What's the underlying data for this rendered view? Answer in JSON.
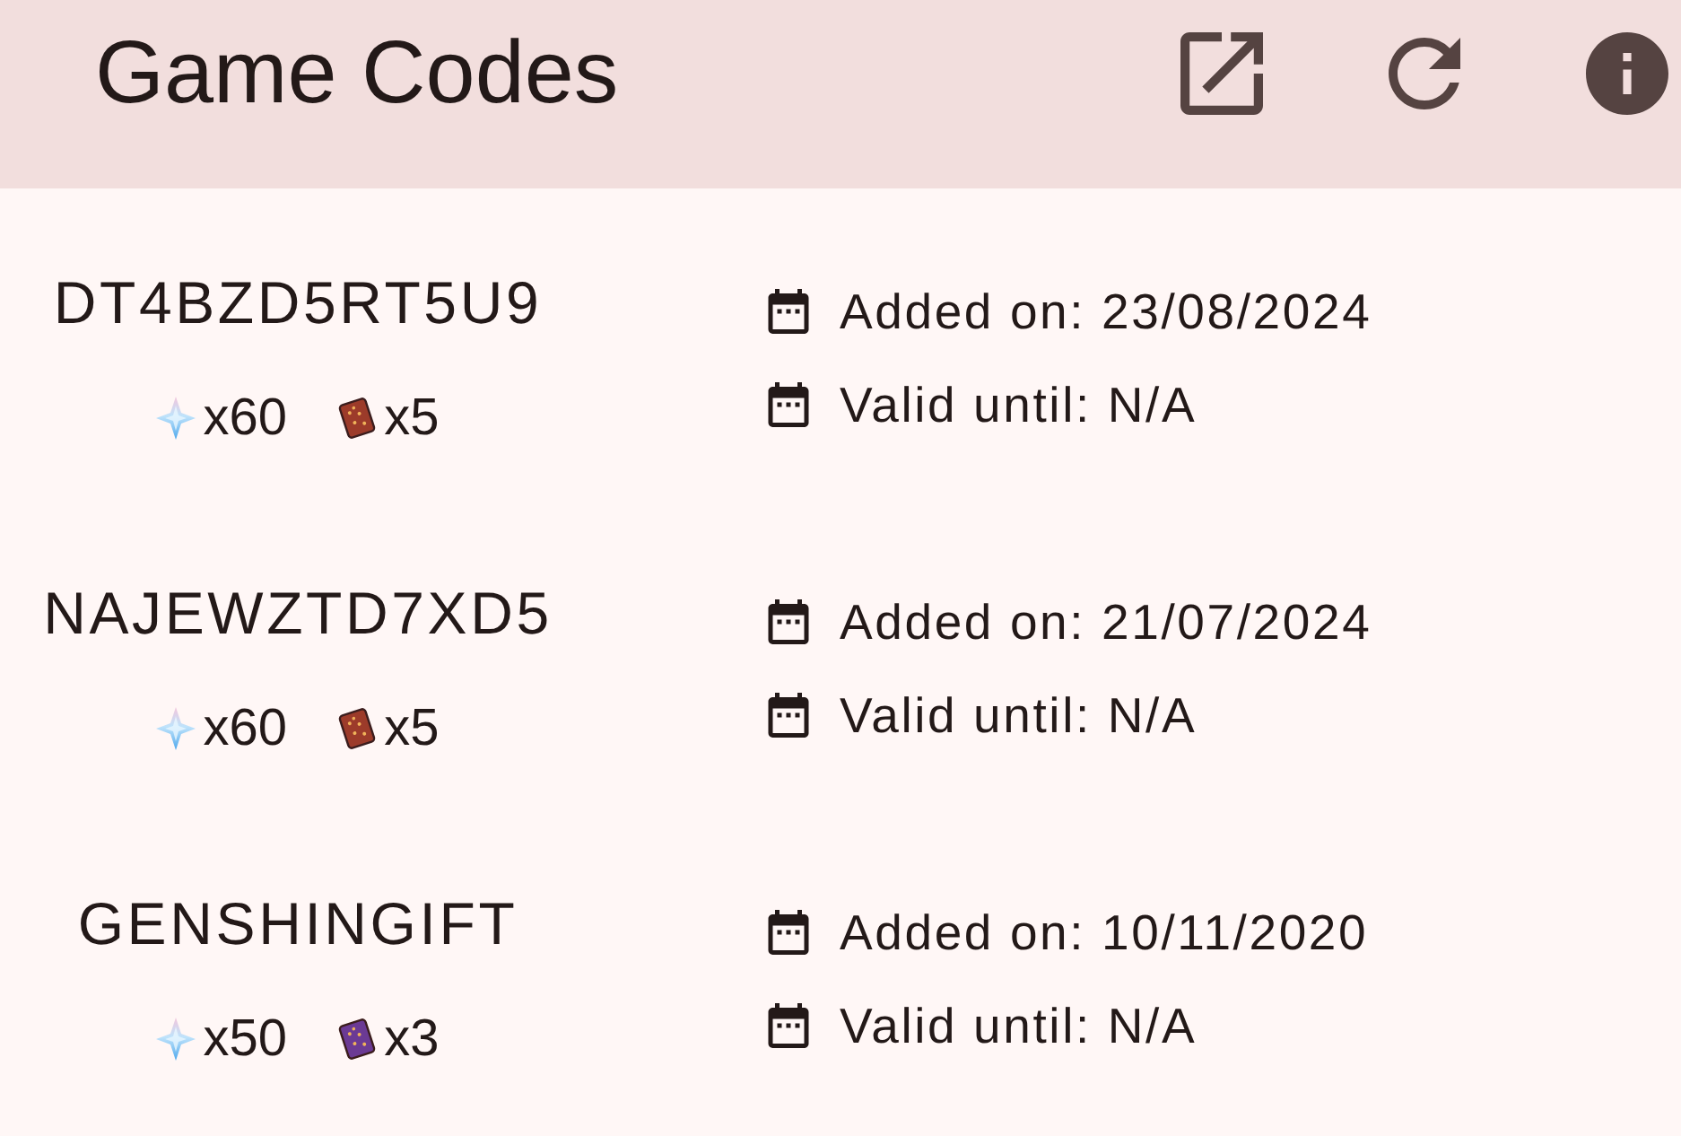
{
  "app_bar": {
    "title": "Game Codes"
  },
  "codes": [
    {
      "code": "DT4BZD5RT5U9",
      "rewards": [
        {
          "kind": "gem",
          "amount": "x60"
        },
        {
          "kind": "book",
          "color": "#9c3b2a",
          "amount": "x5"
        }
      ],
      "dates": [
        "Added on: 23/08/2024",
        "Valid until: N/A"
      ]
    },
    {
      "code": "NAJEWZTD7XD5",
      "rewards": [
        {
          "kind": "gem",
          "amount": "x60"
        },
        {
          "kind": "book",
          "color": "#9c3b2a",
          "amount": "x5"
        }
      ],
      "dates": [
        "Added on: 21/07/2024",
        "Valid until: N/A"
      ]
    },
    {
      "code": "GENSHINGIFT",
      "rewards": [
        {
          "kind": "gem",
          "amount": "x50"
        },
        {
          "kind": "book",
          "color": "#6b3a94",
          "amount": "x3"
        }
      ],
      "dates": [
        "Added on: 10/11/2020",
        "Valid until: N/A"
      ]
    }
  ]
}
